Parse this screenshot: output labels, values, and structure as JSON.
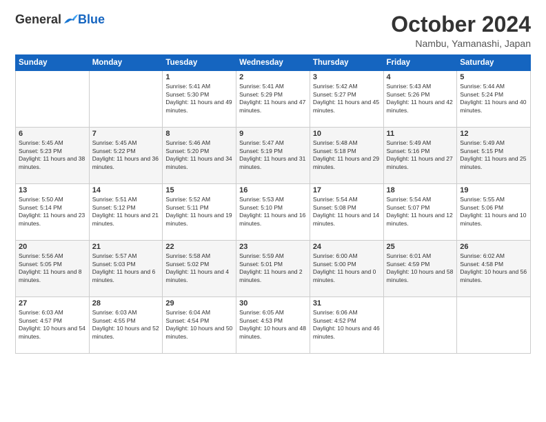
{
  "header": {
    "logo_general": "General",
    "logo_blue": "Blue",
    "month_title": "October 2024",
    "location": "Nambu, Yamanashi, Japan"
  },
  "days_of_week": [
    "Sunday",
    "Monday",
    "Tuesday",
    "Wednesday",
    "Thursday",
    "Friday",
    "Saturday"
  ],
  "weeks": [
    [
      null,
      null,
      {
        "day": 1,
        "sunrise": "5:41 AM",
        "sunset": "5:30 PM",
        "daylight": "11 hours and 49 minutes."
      },
      {
        "day": 2,
        "sunrise": "5:41 AM",
        "sunset": "5:29 PM",
        "daylight": "11 hours and 47 minutes."
      },
      {
        "day": 3,
        "sunrise": "5:42 AM",
        "sunset": "5:27 PM",
        "daylight": "11 hours and 45 minutes."
      },
      {
        "day": 4,
        "sunrise": "5:43 AM",
        "sunset": "5:26 PM",
        "daylight": "11 hours and 42 minutes."
      },
      {
        "day": 5,
        "sunrise": "5:44 AM",
        "sunset": "5:24 PM",
        "daylight": "11 hours and 40 minutes."
      }
    ],
    [
      {
        "day": 6,
        "sunrise": "5:45 AM",
        "sunset": "5:23 PM",
        "daylight": "11 hours and 38 minutes."
      },
      {
        "day": 7,
        "sunrise": "5:45 AM",
        "sunset": "5:22 PM",
        "daylight": "11 hours and 36 minutes."
      },
      {
        "day": 8,
        "sunrise": "5:46 AM",
        "sunset": "5:20 PM",
        "daylight": "11 hours and 34 minutes."
      },
      {
        "day": 9,
        "sunrise": "5:47 AM",
        "sunset": "5:19 PM",
        "daylight": "11 hours and 31 minutes."
      },
      {
        "day": 10,
        "sunrise": "5:48 AM",
        "sunset": "5:18 PM",
        "daylight": "11 hours and 29 minutes."
      },
      {
        "day": 11,
        "sunrise": "5:49 AM",
        "sunset": "5:16 PM",
        "daylight": "11 hours and 27 minutes."
      },
      {
        "day": 12,
        "sunrise": "5:49 AM",
        "sunset": "5:15 PM",
        "daylight": "11 hours and 25 minutes."
      }
    ],
    [
      {
        "day": 13,
        "sunrise": "5:50 AM",
        "sunset": "5:14 PM",
        "daylight": "11 hours and 23 minutes."
      },
      {
        "day": 14,
        "sunrise": "5:51 AM",
        "sunset": "5:12 PM",
        "daylight": "11 hours and 21 minutes."
      },
      {
        "day": 15,
        "sunrise": "5:52 AM",
        "sunset": "5:11 PM",
        "daylight": "11 hours and 19 minutes."
      },
      {
        "day": 16,
        "sunrise": "5:53 AM",
        "sunset": "5:10 PM",
        "daylight": "11 hours and 16 minutes."
      },
      {
        "day": 17,
        "sunrise": "5:54 AM",
        "sunset": "5:08 PM",
        "daylight": "11 hours and 14 minutes."
      },
      {
        "day": 18,
        "sunrise": "5:54 AM",
        "sunset": "5:07 PM",
        "daylight": "11 hours and 12 minutes."
      },
      {
        "day": 19,
        "sunrise": "5:55 AM",
        "sunset": "5:06 PM",
        "daylight": "11 hours and 10 minutes."
      }
    ],
    [
      {
        "day": 20,
        "sunrise": "5:56 AM",
        "sunset": "5:05 PM",
        "daylight": "11 hours and 8 minutes."
      },
      {
        "day": 21,
        "sunrise": "5:57 AM",
        "sunset": "5:03 PM",
        "daylight": "11 hours and 6 minutes."
      },
      {
        "day": 22,
        "sunrise": "5:58 AM",
        "sunset": "5:02 PM",
        "daylight": "11 hours and 4 minutes."
      },
      {
        "day": 23,
        "sunrise": "5:59 AM",
        "sunset": "5:01 PM",
        "daylight": "11 hours and 2 minutes."
      },
      {
        "day": 24,
        "sunrise": "6:00 AM",
        "sunset": "5:00 PM",
        "daylight": "11 hours and 0 minutes."
      },
      {
        "day": 25,
        "sunrise": "6:01 AM",
        "sunset": "4:59 PM",
        "daylight": "10 hours and 58 minutes."
      },
      {
        "day": 26,
        "sunrise": "6:02 AM",
        "sunset": "4:58 PM",
        "daylight": "10 hours and 56 minutes."
      }
    ],
    [
      {
        "day": 27,
        "sunrise": "6:03 AM",
        "sunset": "4:57 PM",
        "daylight": "10 hours and 54 minutes."
      },
      {
        "day": 28,
        "sunrise": "6:03 AM",
        "sunset": "4:55 PM",
        "daylight": "10 hours and 52 minutes."
      },
      {
        "day": 29,
        "sunrise": "6:04 AM",
        "sunset": "4:54 PM",
        "daylight": "10 hours and 50 minutes."
      },
      {
        "day": 30,
        "sunrise": "6:05 AM",
        "sunset": "4:53 PM",
        "daylight": "10 hours and 48 minutes."
      },
      {
        "day": 31,
        "sunrise": "6:06 AM",
        "sunset": "4:52 PM",
        "daylight": "10 hours and 46 minutes."
      },
      null,
      null
    ]
  ]
}
